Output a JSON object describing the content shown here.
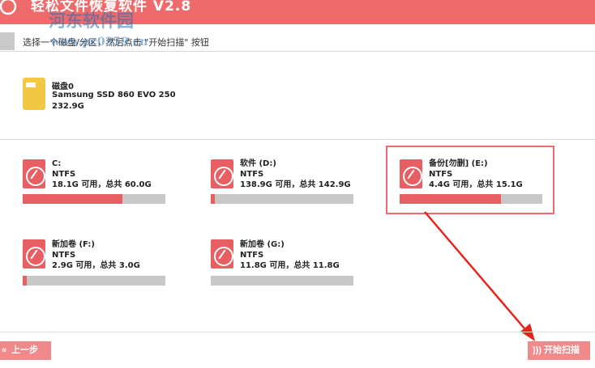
{
  "window": {
    "title": "轻松文件恢复软件 V2.8"
  },
  "watermark": {
    "text": "河东软件园",
    "url": "www.pc0359.cn"
  },
  "hint": {
    "text": "选择一个磁盘/分区，然后点击 \"开始扫描\" 按钮"
  },
  "disk": {
    "name": "磁盘0",
    "model": "Samsung SSD 860 EVO 250",
    "size": "232.9G"
  },
  "volumes": [
    {
      "name": "C:",
      "fs": "NTFS",
      "usage": "18.1G 可用，总共 60.0G",
      "used_fraction": 0.7,
      "selected": false
    },
    {
      "name": "软件 (D:)",
      "fs": "NTFS",
      "usage": "138.9G 可用，总共 142.9G",
      "used_fraction": 0.03,
      "selected": false
    },
    {
      "name": "备份[勿删] (E:)",
      "fs": "NTFS",
      "usage": "4.4G 可用，总共 15.1G",
      "used_fraction": 0.71,
      "selected": true
    },
    {
      "name": "新加卷 (F:)",
      "fs": "NTFS",
      "usage": "2.9G 可用，总共 3.0G",
      "used_fraction": 0.03,
      "selected": false
    },
    {
      "name": "新加卷 (G:)",
      "fs": "NTFS",
      "usage": "11.8G 可用，总共 11.8G",
      "used_fraction": 0.0,
      "selected": false
    }
  ],
  "buttons": {
    "back": "上一步",
    "back_icon": "double-chevron-left",
    "start": "开始扫描",
    "start_icon": "signal-waves"
  },
  "colors": {
    "accent": "#ef6b6b",
    "bar_fill": "#e85f63",
    "bar_track": "#c7c7c7",
    "disk_icon": "#f2c744",
    "button": "#f08a8a"
  }
}
